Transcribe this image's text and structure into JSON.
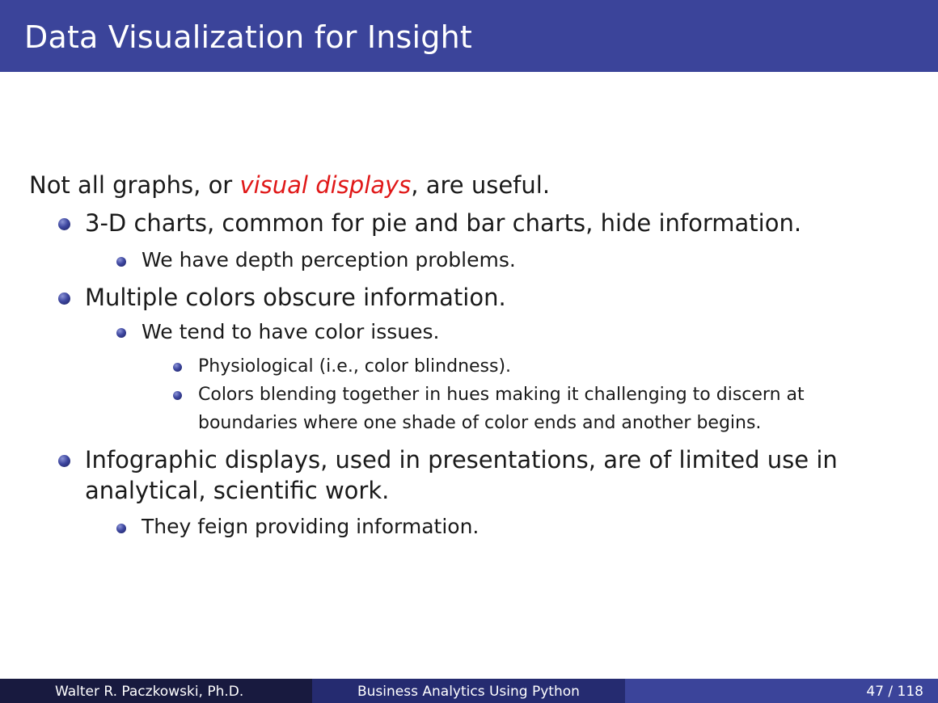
{
  "slide": {
    "title": "Data Visualization for Insight"
  },
  "content": {
    "intro_prefix": "Not all graphs, or ",
    "intro_emph": "visual displays",
    "intro_suffix": ", are useful.",
    "item1": "3-D charts, common for pie and bar charts, hide information.",
    "item1_sub1": "We have depth perception problems.",
    "item2": "Multiple colors obscure information.",
    "item2_sub1": "We tend to have color issues.",
    "item2_sub1_sub1": "Physiological (i.e., color blindness).",
    "item2_sub1_sub2_line1": "Colors blending together in hues making it challenging to discern at",
    "item2_sub1_sub2_line2": "boundaries where one shade of color ends and another begins.",
    "item3_line1": "Infographic displays, used in presentations, are of limited use in",
    "item3_line2": "analytical, scientific work.",
    "item3_sub1": "They feign providing information."
  },
  "footer": {
    "author": "Walter R. Paczkowski, Ph.D.",
    "course": "Business Analytics Using Python",
    "page": "47 / 118"
  },
  "colors": {
    "header": "#3b449a",
    "alert": "#e01818",
    "footer_left": "#181a3f",
    "footer_mid": "#252b70",
    "footer_right": "#3b449a"
  }
}
